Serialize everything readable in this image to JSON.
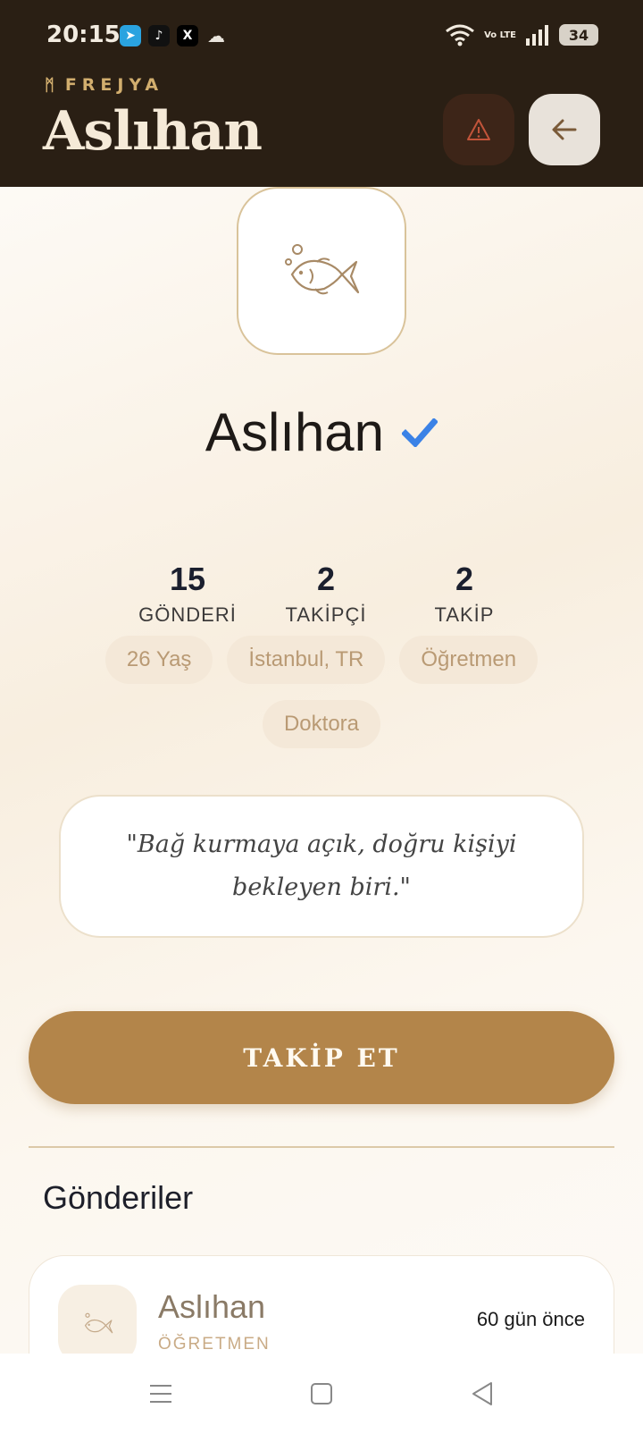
{
  "status_bar": {
    "time": "20:15",
    "notifications": [
      "telegram-icon",
      "tiktok-icon",
      "x-icon",
      "cloud-icon"
    ],
    "volte": "Vo LTE",
    "battery": "34"
  },
  "header": {
    "brand": "FREJYA",
    "title": "Aslıhan",
    "report_icon": "warning-icon",
    "back_icon": "arrow-left-icon"
  },
  "profile": {
    "name": "Aslıhan",
    "verified": true,
    "avatar_icon": "fish-icon",
    "stats": [
      {
        "value": "15",
        "label": "GÖNDERİ"
      },
      {
        "value": "2",
        "label": "TAKİPÇİ"
      },
      {
        "value": "2",
        "label": "TAKİP"
      }
    ],
    "chips": [
      "26 Yaş",
      "İstanbul, TR",
      "Öğretmen",
      "Doktora"
    ],
    "quote": "\"Bağ kurmaya açık, doğru kişiyi bekleyen biri.\"",
    "follow_label": "TAKİP ET"
  },
  "posts_section": {
    "title": "Gönderiler",
    "posts": [
      {
        "author": "Aslıhan",
        "role": "ÖĞRETMEN",
        "time": "60 gün önce"
      }
    ]
  },
  "colors": {
    "header_bg": "#2a1f14",
    "accent": "#b3854a",
    "brand_gold": "#d2ae6e",
    "verified_blue": "#3b82e6"
  }
}
